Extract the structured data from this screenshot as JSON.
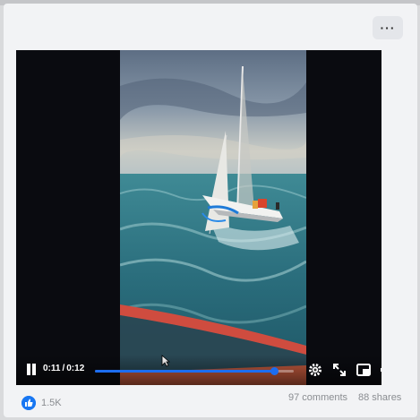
{
  "post": {
    "more_options_label": "···",
    "more_options_icon": "more-horizontal-icon"
  },
  "video": {
    "scene": "sailboat on rough sea viewed from rescue boat",
    "current_time": "0:11",
    "separator": "/",
    "duration": "0:12",
    "progress_fraction": 0.9,
    "accent_color": "#1c6df0",
    "control_icons": [
      "pause-icon",
      "settings-icon",
      "fullscreen-icon",
      "picture-in-picture-icon",
      "volume-icon"
    ]
  },
  "stats": {
    "reactions": "1.5K",
    "comments": "97 comments",
    "shares": "88 shares",
    "reaction_icon": "like-icon",
    "reaction_color": "#1877f2"
  }
}
